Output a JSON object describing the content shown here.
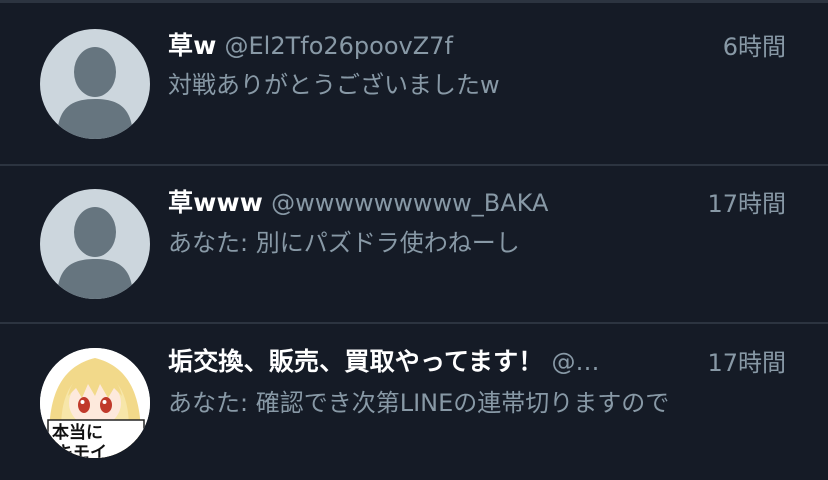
{
  "conversations": [
    {
      "display_name": "草w",
      "handle": "@El2Tfo26poovZ7f",
      "time": "6時間",
      "preview": "対戦ありがとうございましたw",
      "avatar": "default-avatar-icon"
    },
    {
      "display_name": "草www",
      "handle": "@wwwwwwwww_BAKA",
      "time": "17時間",
      "preview": "あなた: 別にパズドラ使わねーし",
      "avatar": "default-avatar-icon"
    },
    {
      "display_name": "垢交換、販売、買取やってます！",
      "handle": "@…",
      "time": "17時間",
      "preview": "あなた: 確認でき次第LINEの連帯切りますので",
      "avatar": "anime-avatar-image",
      "avatar_text": "本当にキモイ"
    }
  ],
  "colors": {
    "background": "#151b26",
    "divider": "#2c3440",
    "secondary_text": "#8899a6",
    "primary_text": "#ffffff",
    "default_avatar_bg": "#ccd6dd",
    "default_avatar_figure": "#66757f"
  }
}
